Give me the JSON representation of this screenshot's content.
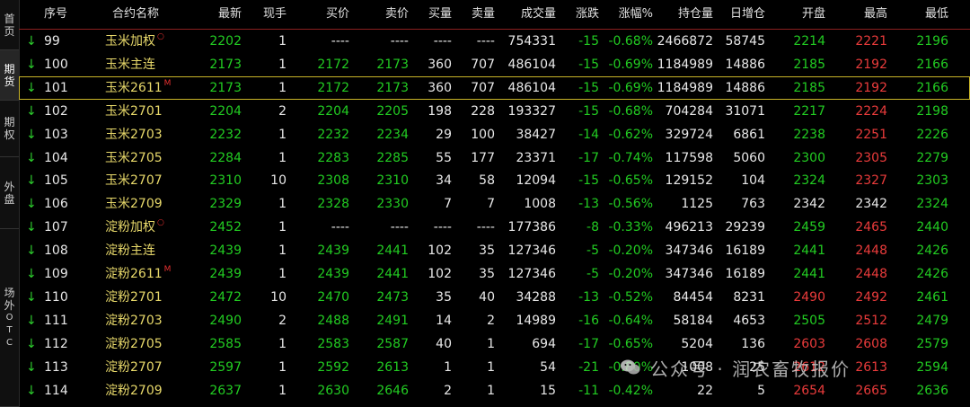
{
  "sidebar": {
    "tabs": [
      {
        "label": "首页",
        "active": false
      },
      {
        "label": "期货",
        "active": true
      },
      {
        "label": "期权",
        "active": false
      },
      {
        "label": "外盘",
        "active": false
      },
      {
        "label": "场外OTC",
        "active": false
      }
    ]
  },
  "header": {
    "columns": [
      "序号",
      "合约名称",
      "最新",
      "现手",
      "买价",
      "卖价",
      "买量",
      "卖量",
      "成交量",
      "涨跌",
      "涨幅%",
      "持仓量",
      "日增仓",
      "开盘",
      "最高",
      "最低"
    ]
  },
  "rows": [
    {
      "arrow": "↓",
      "idx": "99",
      "name": "玉米加权",
      "mark": "○",
      "last": "2202",
      "hand": "1",
      "bid": "----",
      "ask": "----",
      "bidv": "----",
      "askv": "----",
      "vol": "754331",
      "chg": "-15",
      "pct": "-0.68%",
      "oi": "2466872",
      "dinc": "58745",
      "open": "2214",
      "high": "2221",
      "low": "2196",
      "open_c": "g",
      "high_c": "r",
      "low_c": "g"
    },
    {
      "arrow": "↓",
      "idx": "100",
      "name": "玉米主连",
      "mark": "",
      "last": "2173",
      "hand": "1",
      "bid": "2172",
      "ask": "2173",
      "bidv": "360",
      "askv": "707",
      "vol": "486104",
      "chg": "-15",
      "pct": "-0.69%",
      "oi": "1184989",
      "dinc": "14886",
      "open": "2185",
      "high": "2192",
      "low": "2166",
      "open_c": "g",
      "high_c": "r",
      "low_c": "g"
    },
    {
      "arrow": "↓",
      "idx": "101",
      "name": "玉米2611",
      "mark": "M",
      "last": "2173",
      "hand": "1",
      "bid": "2172",
      "ask": "2173",
      "bidv": "360",
      "askv": "707",
      "vol": "486104",
      "chg": "-15",
      "pct": "-0.69%",
      "oi": "1184989",
      "dinc": "14886",
      "open": "2185",
      "high": "2192",
      "low": "2166",
      "open_c": "g",
      "high_c": "r",
      "low_c": "g",
      "selected": true
    },
    {
      "arrow": "↓",
      "idx": "102",
      "name": "玉米2701",
      "mark": "",
      "last": "2204",
      "hand": "2",
      "bid": "2204",
      "ask": "2205",
      "bidv": "198",
      "askv": "228",
      "vol": "193327",
      "chg": "-15",
      "pct": "-0.68%",
      "oi": "704284",
      "dinc": "31071",
      "open": "2217",
      "high": "2224",
      "low": "2198",
      "open_c": "g",
      "high_c": "r",
      "low_c": "g"
    },
    {
      "arrow": "↓",
      "idx": "103",
      "name": "玉米2703",
      "mark": "",
      "last": "2232",
      "hand": "1",
      "bid": "2232",
      "ask": "2234",
      "bidv": "29",
      "askv": "100",
      "vol": "38427",
      "chg": "-14",
      "pct": "-0.62%",
      "oi": "329724",
      "dinc": "6861",
      "open": "2238",
      "high": "2251",
      "low": "2226",
      "open_c": "g",
      "high_c": "r",
      "low_c": "g"
    },
    {
      "arrow": "↓",
      "idx": "104",
      "name": "玉米2705",
      "mark": "",
      "last": "2284",
      "hand": "1",
      "bid": "2283",
      "ask": "2285",
      "bidv": "55",
      "askv": "177",
      "vol": "23371",
      "chg": "-17",
      "pct": "-0.74%",
      "oi": "117598",
      "dinc": "5060",
      "open": "2300",
      "high": "2305",
      "low": "2279",
      "open_c": "g",
      "high_c": "r",
      "low_c": "g"
    },
    {
      "arrow": "↓",
      "idx": "105",
      "name": "玉米2707",
      "mark": "",
      "last": "2310",
      "hand": "10",
      "bid": "2308",
      "ask": "2310",
      "bidv": "34",
      "askv": "58",
      "vol": "12094",
      "chg": "-15",
      "pct": "-0.65%",
      "oi": "129152",
      "dinc": "104",
      "open": "2324",
      "high": "2327",
      "low": "2303",
      "open_c": "g",
      "high_c": "r",
      "low_c": "g"
    },
    {
      "arrow": "↓",
      "idx": "106",
      "name": "玉米2709",
      "mark": "",
      "last": "2329",
      "hand": "1",
      "bid": "2328",
      "ask": "2330",
      "bidv": "7",
      "askv": "7",
      "vol": "1008",
      "chg": "-13",
      "pct": "-0.56%",
      "oi": "1125",
      "dinc": "763",
      "open": "2342",
      "high": "2342",
      "low": "2324",
      "open_c": "w",
      "high_c": "w",
      "low_c": "g"
    },
    {
      "arrow": "↓",
      "idx": "107",
      "name": "淀粉加权",
      "mark": "○",
      "last": "2452",
      "hand": "1",
      "bid": "----",
      "ask": "----",
      "bidv": "----",
      "askv": "----",
      "vol": "177386",
      "chg": "-8",
      "pct": "-0.33%",
      "oi": "496213",
      "dinc": "29239",
      "open": "2459",
      "high": "2465",
      "low": "2440",
      "open_c": "g",
      "high_c": "r",
      "low_c": "g"
    },
    {
      "arrow": "↓",
      "idx": "108",
      "name": "淀粉主连",
      "mark": "",
      "last": "2439",
      "hand": "1",
      "bid": "2439",
      "ask": "2441",
      "bidv": "102",
      "askv": "35",
      "vol": "127346",
      "chg": "-5",
      "pct": "-0.20%",
      "oi": "347346",
      "dinc": "16189",
      "open": "2441",
      "high": "2448",
      "low": "2426",
      "open_c": "g",
      "high_c": "r",
      "low_c": "g"
    },
    {
      "arrow": "↓",
      "idx": "109",
      "name": "淀粉2611",
      "mark": "M",
      "last": "2439",
      "hand": "1",
      "bid": "2439",
      "ask": "2441",
      "bidv": "102",
      "askv": "35",
      "vol": "127346",
      "chg": "-5",
      "pct": "-0.20%",
      "oi": "347346",
      "dinc": "16189",
      "open": "2441",
      "high": "2448",
      "low": "2426",
      "open_c": "g",
      "high_c": "r",
      "low_c": "g"
    },
    {
      "arrow": "↓",
      "idx": "110",
      "name": "淀粉2701",
      "mark": "",
      "last": "2472",
      "hand": "10",
      "bid": "2470",
      "ask": "2473",
      "bidv": "35",
      "askv": "40",
      "vol": "34288",
      "chg": "-13",
      "pct": "-0.52%",
      "oi": "84454",
      "dinc": "8231",
      "open": "2490",
      "high": "2492",
      "low": "2461",
      "open_c": "r",
      "high_c": "r",
      "low_c": "g"
    },
    {
      "arrow": "↓",
      "idx": "111",
      "name": "淀粉2703",
      "mark": "",
      "last": "2490",
      "hand": "2",
      "bid": "2488",
      "ask": "2491",
      "bidv": "14",
      "askv": "2",
      "vol": "14989",
      "chg": "-16",
      "pct": "-0.64%",
      "oi": "58184",
      "dinc": "4653",
      "open": "2505",
      "high": "2512",
      "low": "2479",
      "open_c": "g",
      "high_c": "r",
      "low_c": "g"
    },
    {
      "arrow": "↓",
      "idx": "112",
      "name": "淀粉2705",
      "mark": "",
      "last": "2585",
      "hand": "1",
      "bid": "2583",
      "ask": "2587",
      "bidv": "40",
      "askv": "1",
      "vol": "694",
      "chg": "-17",
      "pct": "-0.65%",
      "oi": "5204",
      "dinc": "136",
      "open": "2603",
      "high": "2608",
      "low": "2579",
      "open_c": "r",
      "high_c": "r",
      "low_c": "g"
    },
    {
      "arrow": "↓",
      "idx": "113",
      "name": "淀粉2707",
      "mark": "",
      "last": "2597",
      "hand": "1",
      "bid": "2592",
      "ask": "2613",
      "bidv": "1",
      "askv": "1",
      "vol": "54",
      "chg": "-21",
      "pct": "-0.80%",
      "oi": "1008",
      "dinc": "25",
      "open": "2612",
      "high": "2613",
      "low": "2594",
      "open_c": "r",
      "high_c": "r",
      "low_c": "g"
    },
    {
      "arrow": "↓",
      "idx": "114",
      "name": "淀粉2709",
      "mark": "",
      "last": "2637",
      "hand": "1",
      "bid": "2630",
      "ask": "2646",
      "bidv": "2",
      "askv": "1",
      "vol": "15",
      "chg": "-11",
      "pct": "-0.42%",
      "oi": "22",
      "dinc": "5",
      "open": "2654",
      "high": "2665",
      "low": "2636",
      "open_c": "r",
      "high_c": "r",
      "low_c": "g"
    }
  ],
  "watermark": {
    "text": "公众号 · 润农畜牧报价",
    "icon": "wechat-icon"
  },
  "colors": {
    "down": "#22cc22",
    "up": "#ea3b3b",
    "name": "#e7d86a",
    "header_line": "#8a1f1f",
    "selected_outline": "#c8b428"
  }
}
